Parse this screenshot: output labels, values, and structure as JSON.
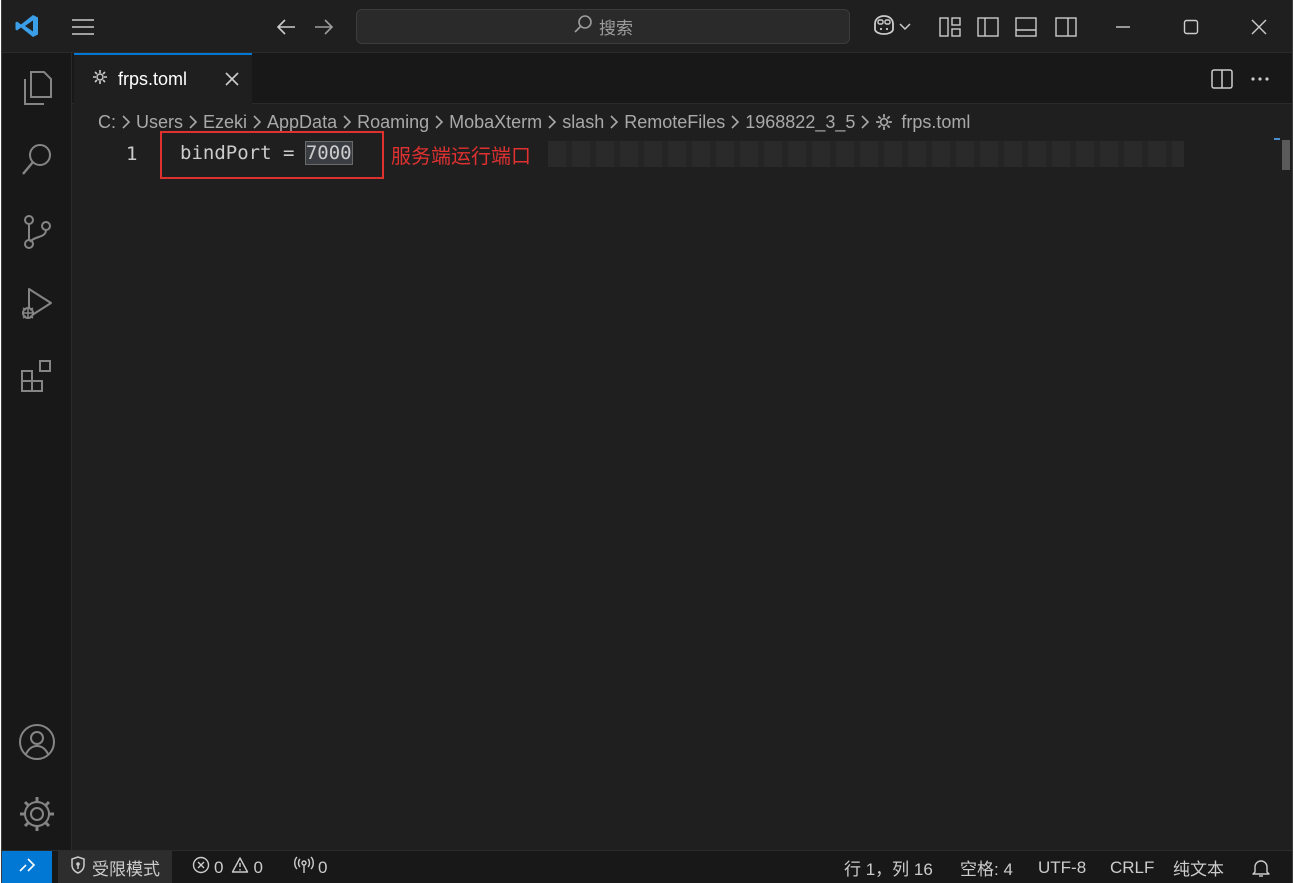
{
  "titlebar": {
    "search_label": "搜索"
  },
  "tab": {
    "filename": "frps.toml"
  },
  "breadcrumb": {
    "segments": [
      "C:",
      "Users",
      "Ezeki",
      "AppData",
      "Roaming",
      "MobaXterm",
      "slash",
      "RemoteFiles",
      "1968822_3_5"
    ],
    "file": "frps.toml"
  },
  "editor": {
    "line_number": "1",
    "code_key": "bindPort = ",
    "code_value": "7000",
    "annotation": "服务端运行端口"
  },
  "statusbar": {
    "restricted_mode": "受限模式",
    "errors": "0",
    "warnings": "0",
    "ports": "0",
    "cursor": "行 1，列 16",
    "indent": "空格: 4",
    "encoding": "UTF-8",
    "eol": "CRLF",
    "language": "纯文本"
  },
  "colors": {
    "accent": "#0078d4",
    "annotation": "#e03131",
    "background": "#1f1f1f"
  }
}
